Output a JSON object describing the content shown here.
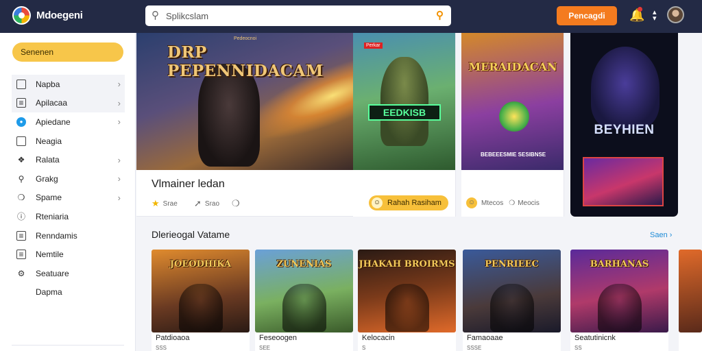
{
  "header": {
    "app_title": "Mdoegeni",
    "search_placeholder": "Splikcslam",
    "cta_label": "Pencagdi"
  },
  "sidebar": {
    "primary_button": "Senenen",
    "items": [
      {
        "label": "Napba",
        "icon": "square-icon"
      },
      {
        "label": "Apilacaa",
        "icon": "document-icon"
      },
      {
        "label": "Apiedane",
        "icon": "blue-circle-icon"
      },
      {
        "label": "Neagia",
        "icon": "square-icon"
      },
      {
        "label": "Ralata",
        "icon": "compass-icon"
      },
      {
        "label": "Grakg",
        "icon": "search-icon"
      },
      {
        "label": "Spame",
        "icon": "tag-icon"
      },
      {
        "label": "Rteniaria",
        "icon": "info-icon"
      },
      {
        "label": "Renndamis",
        "icon": "grid-icon"
      },
      {
        "label": "Nemtile",
        "icon": "list-icon"
      },
      {
        "label": "Seatuare",
        "icon": "settings-icon"
      },
      {
        "label": "Dapma",
        "icon": ""
      }
    ]
  },
  "featured": {
    "hero": {
      "art_title": "DRP PEPENNIDACAM",
      "art_subtitle": "Pedeocnoi",
      "name": "Vlmainer ledan",
      "meta": [
        {
          "icon": "star-icon",
          "label": "Srae"
        },
        {
          "icon": "pin-icon",
          "label": "Srao"
        },
        {
          "icon": "tag-icon",
          "label": ""
        }
      ]
    },
    "card_green": {
      "tag": "Perkar",
      "art_label": "EEDKISB",
      "button": "Rahah Rasiham"
    },
    "card_orange": {
      "art_title": "MERAIDACAN",
      "art_bottom": "BEBEEESMIE SESIBNSE",
      "meta": [
        "Mtecos",
        "Meocis"
      ]
    },
    "poster": {
      "title": "BEYHIEN"
    }
  },
  "section": {
    "title": "Dlerieogal Vatame",
    "see_all": "Saen"
  },
  "tiles": [
    {
      "art": "JOEODHIKA",
      "name": "Patdioaoa",
      "sub": "SSS"
    },
    {
      "art": "ZUNENIAS",
      "name": "Feseoogen",
      "sub": "SEE"
    },
    {
      "art": "JHAKAH BROIRMS",
      "name": "Kelocacin",
      "sub": "S"
    },
    {
      "art": "PENRIEEC",
      "name": "Famaoaae",
      "sub": "SSSE"
    },
    {
      "art": "BARHANAS",
      "name": "Seatutinicnk",
      "sub": "SS"
    },
    {
      "art": "",
      "name": "",
      "sub": ""
    }
  ]
}
